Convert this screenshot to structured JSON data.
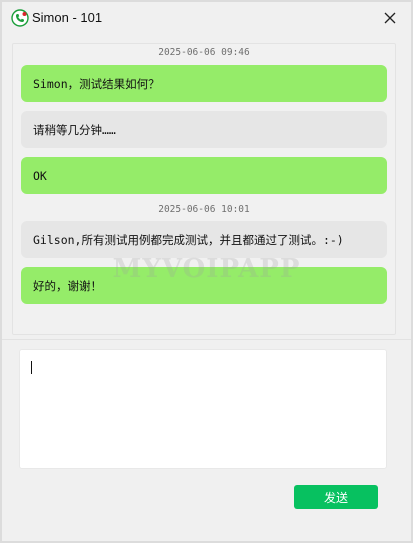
{
  "window": {
    "title": "Simon - 101",
    "icon": "phone-app-icon"
  },
  "chat": {
    "messages": [
      {
        "kind": "timestamp",
        "text": "2025-06-06 09:46"
      },
      {
        "kind": "sent",
        "text": "Simon，测试结果如何？"
      },
      {
        "kind": "received",
        "text": "请稍等几分钟……"
      },
      {
        "kind": "sent",
        "text": "OK"
      },
      {
        "kind": "timestamp",
        "text": "2025-06-06 10:01"
      },
      {
        "kind": "received",
        "text": "Gilson,所有测试用例都完成测试，并且都通过了测试。:-)"
      },
      {
        "kind": "sent",
        "text": "好的，谢谢！"
      }
    ]
  },
  "watermark": "MYVOIPAPP",
  "composer": {
    "value": "",
    "send_label": "发送"
  },
  "colors": {
    "sent_bubble": "#95ec69",
    "received_bubble": "#e6e6e6",
    "send_button": "#07c160",
    "window_bg": "#f0f0f0"
  }
}
